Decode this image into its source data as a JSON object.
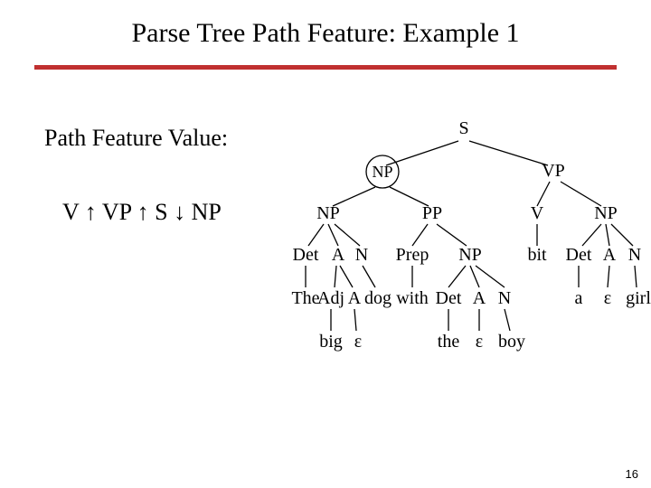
{
  "title": "Parse Tree Path Feature: Example 1",
  "page_number": "16",
  "left_panel": {
    "heading": "Path Feature Value:",
    "value": "V ↑ VP ↑ S ↓ NP"
  },
  "tree": {
    "S": "S",
    "NP_top": "NP",
    "VP": "VP",
    "NP_l": "NP",
    "PP": "PP",
    "V": "V",
    "NP_r": "NP",
    "Det1": "Det",
    "A1": "A",
    "N1": "N",
    "Prep": "Prep",
    "NP_pp": "NP",
    "verb_bit": "bit",
    "Det3": "Det",
    "A3": "A",
    "N3": "N",
    "The": "The",
    "Adj": "Adj",
    "A2": "A",
    "dog": "dog",
    "with": "with",
    "Det2": "Det",
    "A_mid": "A",
    "N2": "N",
    "a": "a",
    "eps_a": "ε",
    "girl": "girl",
    "big": "big",
    "eps_big": "ε",
    "the": "the",
    "eps_the": "ε",
    "boy": "boy"
  }
}
